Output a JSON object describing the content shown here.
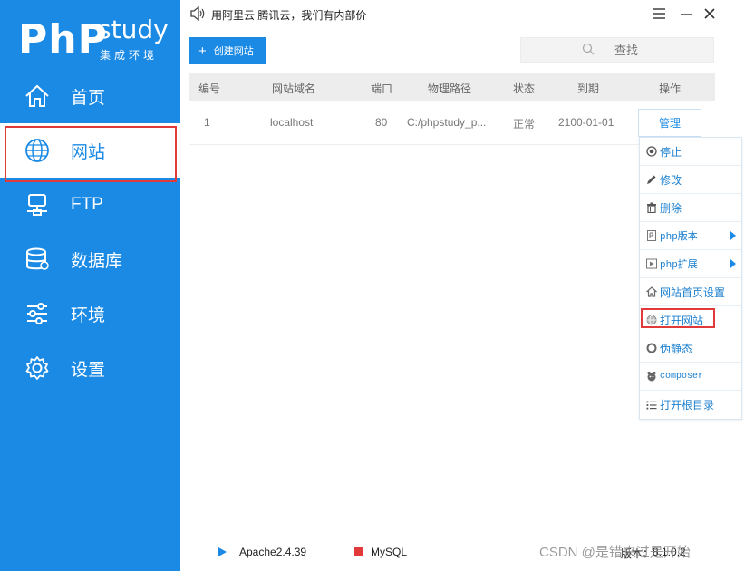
{
  "logo": {
    "brand": "PhP",
    "product": "study",
    "subtitle": "集成环境"
  },
  "sidebar": {
    "items": [
      {
        "label": "首页",
        "icon": "home-icon"
      },
      {
        "label": "网站",
        "icon": "globe-icon",
        "active": true
      },
      {
        "label": "FTP",
        "icon": "ftp-icon"
      },
      {
        "label": "数据库",
        "icon": "database-icon"
      },
      {
        "label": "环境",
        "icon": "sliders-icon"
      },
      {
        "label": "设置",
        "icon": "gear-icon"
      }
    ]
  },
  "topbar": {
    "notice": "用阿里云 腾讯云，我们有内部价"
  },
  "toolbar": {
    "create_label": "创建网站",
    "search_placeholder": "查找"
  },
  "table": {
    "columns": [
      "编号",
      "网站域名",
      "端口",
      "物理路径",
      "状态",
      "到期",
      "操作"
    ],
    "rows": [
      {
        "id": "1",
        "domain": "localhost",
        "port": "80",
        "path": "C:/phpstudy_p...",
        "status": "正常",
        "expire": "2100-01-01",
        "action": "管理"
      }
    ]
  },
  "menu": {
    "items": [
      {
        "label": "停止",
        "icon": "stop-circle-icon"
      },
      {
        "label": "修改",
        "icon": "pencil-icon"
      },
      {
        "label": "删除",
        "icon": "trash-icon"
      },
      {
        "label": "php版本",
        "icon": "php-file-icon",
        "submenu": true
      },
      {
        "label": "php扩展",
        "icon": "php-ext-icon",
        "submenu": true
      },
      {
        "label": "网站首页设置",
        "icon": "home-icon"
      },
      {
        "label": "打开网站",
        "icon": "globe-icon",
        "highlighted": true
      },
      {
        "label": "伪静态",
        "icon": "refresh-icon"
      },
      {
        "label": "composer",
        "icon": "composer-icon"
      },
      {
        "label": "打开根目录",
        "icon": "list-icon"
      }
    ]
  },
  "statusbar": {
    "apache": "Apache2.4.39",
    "mysql": "MySQL",
    "version_label": "版本：",
    "version": "8.1.0.2"
  },
  "watermark": "CSDN @是错来过是开始",
  "colors": {
    "brand_blue": "#1b8ae5",
    "highlight_red": "#e03a3a"
  }
}
